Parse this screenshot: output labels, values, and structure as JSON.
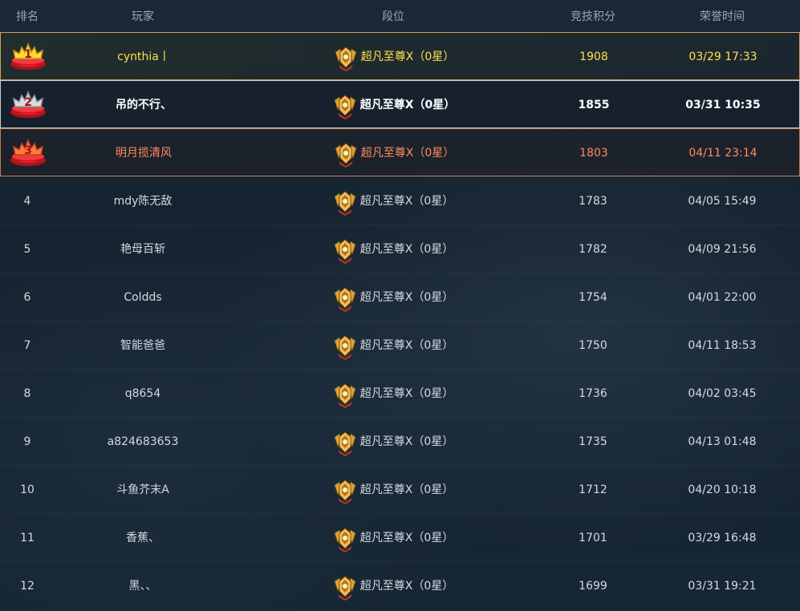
{
  "header": {
    "rank": "排名",
    "player": "玩家",
    "tier": "段位",
    "score": "竞技积分",
    "time": "荣誉时间"
  },
  "colors": {
    "first": "#ffe14a",
    "second": "#ffffff",
    "third": "#ff8a5c",
    "normal": "#d3dbe3",
    "header": "#9aa6b2",
    "first_border": "#c8a64a",
    "second_border": "#c9ced3",
    "third_border": "#c77a55"
  },
  "icons": {
    "rank_medal": "medal-icon",
    "tier_badge": "tier-badge-icon"
  },
  "rows": [
    {
      "rank": "1",
      "player": "cynthia丨",
      "tier": "超凡至尊Ⅹ（0星）",
      "score": "1908",
      "time": "03/29 17:33"
    },
    {
      "rank": "2",
      "player": "吊的不行、",
      "tier": "超凡至尊Ⅹ（0星）",
      "score": "1855",
      "time": "03/31 10:35"
    },
    {
      "rank": "3",
      "player": "明月揽清风",
      "tier": "超凡至尊Ⅹ（0星）",
      "score": "1803",
      "time": "04/11 23:14"
    },
    {
      "rank": "4",
      "player": "mdy陈无敌",
      "tier": "超凡至尊Ⅹ（0星）",
      "score": "1783",
      "time": "04/05 15:49"
    },
    {
      "rank": "5",
      "player": "艳母百斩",
      "tier": "超凡至尊Ⅹ（0星）",
      "score": "1782",
      "time": "04/09 21:56"
    },
    {
      "rank": "6",
      "player": "Coldds",
      "tier": "超凡至尊Ⅹ（0星）",
      "score": "1754",
      "time": "04/01 22:00"
    },
    {
      "rank": "7",
      "player": "智能爸爸",
      "tier": "超凡至尊Ⅹ（0星）",
      "score": "1750",
      "time": "04/11 18:53"
    },
    {
      "rank": "8",
      "player": "q8654",
      "tier": "超凡至尊Ⅹ（0星）",
      "score": "1736",
      "time": "04/02 03:45"
    },
    {
      "rank": "9",
      "player": "a824683653",
      "tier": "超凡至尊Ⅹ（0星）",
      "score": "1735",
      "time": "04/13 01:48"
    },
    {
      "rank": "10",
      "player": "斗鱼芥末A",
      "tier": "超凡至尊Ⅹ（0星）",
      "score": "1712",
      "time": "04/20 10:18"
    },
    {
      "rank": "11",
      "player": "香蕉、",
      "tier": "超凡至尊Ⅹ（0星）",
      "score": "1701",
      "time": "03/29 16:48"
    },
    {
      "rank": "12",
      "player": "黑、、",
      "tier": "超凡至尊Ⅹ（0星）",
      "score": "1699",
      "time": "03/31 19:21"
    }
  ]
}
